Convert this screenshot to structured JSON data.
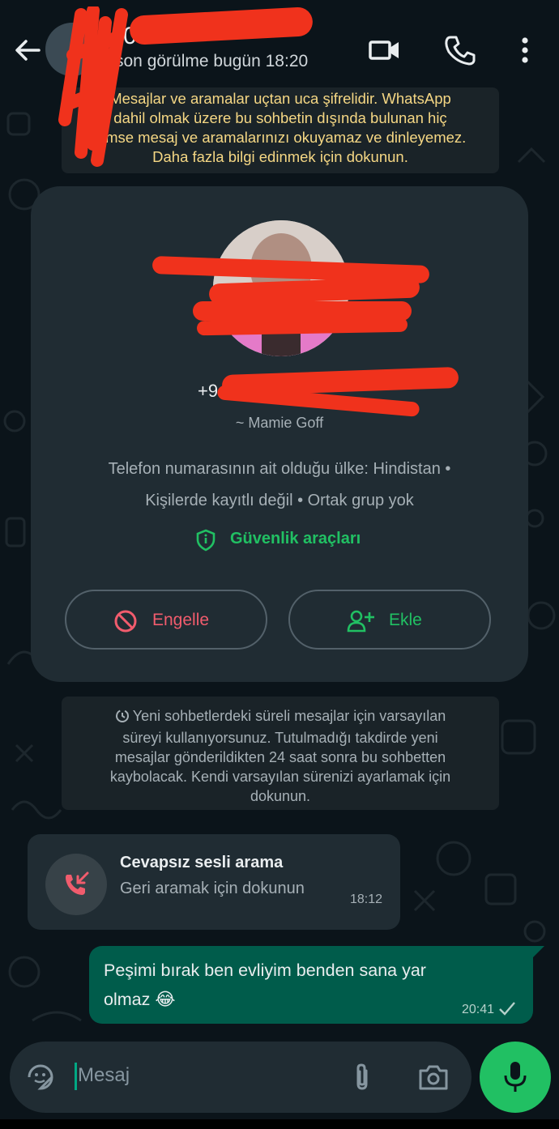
{
  "header": {
    "contact_name_prefix": "0",
    "status": "son görülme bugün 18:20",
    "icons": [
      "back-arrow-icon",
      "video-call-icon",
      "voice-call-icon",
      "more-vert-icon"
    ]
  },
  "encryption_notice": {
    "lines": [
      "Mesajlar ve aramalar uçtan uca şifrelidir. WhatsApp",
      "dahil olmak üzere bu sohbetin dışında bulunan hiç",
      "kimse mesaj ve aramalarınızı okuyamaz ve dinleyemez.",
      "Daha fazla bilgi edinmek için dokunun."
    ],
    "color": "#f5d784"
  },
  "profile_card": {
    "phone_prefix": "+9",
    "push_name": "~ Mamie Goff",
    "info_line1": "Telefon numarasının ait olduğu ülke: Hindistan •",
    "info_line2": "Kişilerde kayıtlı değil • Ortak grup yok",
    "security_tools": "Güvenlik araçları",
    "block_label": "Engelle",
    "add_label": "Ekle",
    "colors": {
      "danger": "#f15c6d",
      "accent": "#21c063"
    }
  },
  "disappearing_notice": {
    "lines": [
      "Yeni sohbetlerdeki süreli mesajlar için varsayılan",
      "süreyi kullanıyorsunuz. Tutulmadığı takdirde yeni",
      "mesajlar gönderildikten 24 saat sonra bu sohbetten",
      "kaybolacak. Kendi varsayılan sürenizi ayarlamak için",
      "dokunun."
    ]
  },
  "missed_call": {
    "title": "Cevapsız sesli arama",
    "subtitle": "Geri aramak için dokunun",
    "time": "18:12"
  },
  "outgoing_message": {
    "line1": "Peşimi bırak ben evliyim benden sana yar",
    "line2": "olmaz 😂",
    "time": "20:41",
    "status": "sent"
  },
  "composer": {
    "placeholder": "Mesaj"
  }
}
